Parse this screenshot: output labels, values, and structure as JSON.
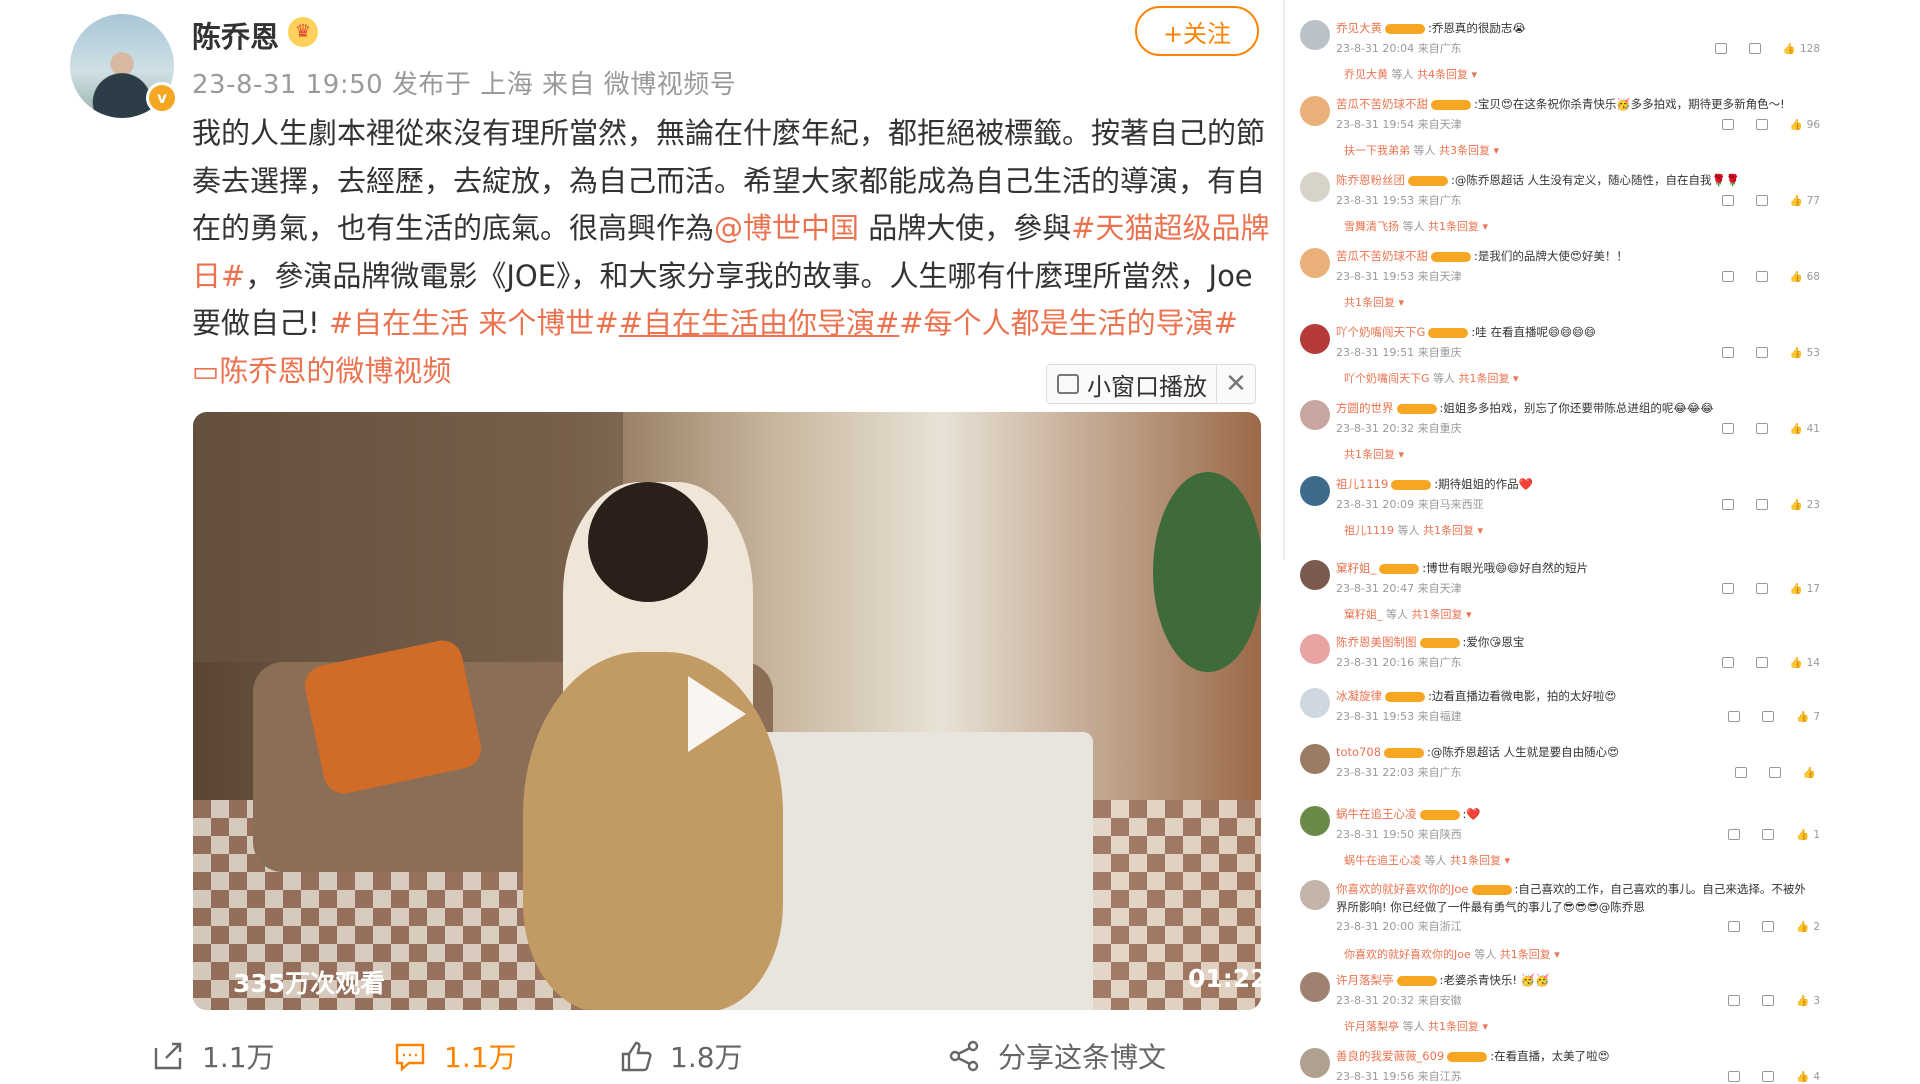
{
  "post": {
    "author": "陈乔恩",
    "meta": "23-8-31 19:50  发布于 上海  来自 微博视频号",
    "follow_label": "+关注",
    "text_1": "我的人生劇本裡從來沒有理所當然，無論在什麼年紀，都拒絕被標籤。按著自己的節奏去選擇，去經歷，去綻放，為自己而活。希望大家都能成為自己生活的導演，有自在的勇氣，也有生活的底氣。很高興作為",
    "mention": "@博世中国",
    "text_2": " 品牌大使，參與",
    "tag_1": "#天猫超级品牌日#",
    "text_3": "，參演品牌微電影《JOE》，和大家分享我的故事。人生哪有什麼理所當然，Joe要做自己! ",
    "tag_2": "#自在生活 来个博世#",
    "tag_3": "#自在生活由你导演#",
    "tag_4": "#每个人都是生活的导演#",
    "video_link": " ▭陈乔恩的微博视频",
    "mini_player_label": "小窗口播放",
    "mini_close": "✕",
    "video_views": "335万次观看",
    "video_duration": "01:22",
    "actions": {
      "repost": "1.1万",
      "comment": "1.1万",
      "like": "1.8万",
      "share": "分享这条博文"
    }
  },
  "comments": [
    {
      "user": "乔见大黄",
      "text": ":乔恩真的很励志😭",
      "meta": "23-8-31 20:04 来自广东",
      "likes": "128",
      "reply_users": "乔见大黄",
      "reply_count": "共4条回复",
      "av": "#b9c2c8"
    },
    {
      "user": "苦瓜不苦奶球不甜",
      "text": ":宝贝😍在这条祝你杀青快乐🥳多多拍戏，期待更多新角色～!",
      "meta": "23-8-31 19:54 来自天津",
      "likes": "96",
      "reply_users": "扶一下我弟弟",
      "reply_count": "共3条回复",
      "av": "#e9b07a"
    },
    {
      "user": "陈乔恩粉丝团",
      "text": ":@陈乔恩超话 人生没有定义，随心随性，自在自我🌹🌹",
      "meta": "23-8-31 19:53 来自广东",
      "likes": "77",
      "reply_users": "雪舞清飞扬",
      "reply_count": "共1条回复",
      "av": "#d8d3c8"
    },
    {
      "user": "苦瓜不苦奶球不甜",
      "text": ":是我们的品牌大使😍好美！！",
      "meta": "23-8-31 19:53 来自天津",
      "likes": "68",
      "reply_users": "",
      "reply_count": "共1条回复",
      "av": "#e9b07a"
    },
    {
      "user": "吖个奶嘴闯天下G",
      "text": ":哇 在看直播呢😄😄😄😄",
      "meta": "23-8-31 19:51 来自重庆",
      "likes": "53",
      "reply_users": "吖个奶嘴闯天下G",
      "reply_count": "共1条回复",
      "av": "#b53a3a"
    },
    {
      "user": "方圆的世界",
      "text": ":姐姐多多拍戏，别忘了你还要带陈总进组的呢😂😂😂",
      "meta": "23-8-31 20:32 来自重庆",
      "likes": "41",
      "reply_users": "",
      "reply_count": "共1条回复",
      "av": "#c8a6a0"
    },
    {
      "user": "祖儿1119",
      "text": ":期待姐姐的作品❤️",
      "meta": "23-8-31 20:09 来自马来西亚",
      "likes": "23",
      "reply_users": "祖儿1119",
      "reply_count": "共1条回复",
      "av": "#3e6a8c"
    },
    {
      "user": "窠籽姐_",
      "text": ":博世有眼光哦😄😄好自然的短片",
      "meta": "23-8-31 20:47 来自天津",
      "likes": "17",
      "reply_users": "窠籽姐_",
      "reply_count": "共1条回复",
      "av": "#7b5a50"
    },
    {
      "user": "陈乔恩美图制图",
      "text": ":爱你😘恩宝",
      "meta": "23-8-31 20:16 来自广东",
      "likes": "14",
      "reply_users": "",
      "reply_count": "",
      "av": "#e8a3a3"
    },
    {
      "user": "冰凝旋律",
      "text": ":边看直播边看微电影，拍的太好啦😍",
      "meta": "23-8-31 19:53 来自福建",
      "likes": "7",
      "reply_users": "",
      "reply_count": "",
      "av": "#cfd8e0"
    },
    {
      "user": "toto708",
      "text": ":@陈乔恩超话 人生就是要自由随心😍",
      "meta": "23-8-31 22:03 来自广东",
      "likes": "",
      "reply_users": "",
      "reply_count": "",
      "av": "#9b7b63"
    },
    {
      "user": "蜗牛在追王心凌",
      "text": ":❤️",
      "meta": "23-8-31 19:50 来自陕西",
      "likes": "1",
      "reply_users": "蜗牛在追王心凌",
      "reply_count": "共1条回复",
      "av": "#6a8a4a"
    },
    {
      "user": "你喜欢的就好喜欢你的Joe",
      "text": ":自己喜欢的工作，自己喜欢的事儿。自己来选择。不被外界所影响! 你已经做了一件最有勇气的事儿了😎😎😎@陈乔恩",
      "meta": "23-8-31 20:00 来自浙江",
      "likes": "2",
      "reply_users": "你喜欢的就好喜欢你的Joe",
      "reply_count": "共1条回复",
      "av": "#c4b3a8"
    },
    {
      "user": "许月落梨亭",
      "text": ":老婆杀青快乐! 🥳🥳",
      "meta": "23-8-31 20:32 来自安徽",
      "likes": "3",
      "reply_users": "许月落梨亭",
      "reply_count": "共1条回复",
      "av": "#a08070"
    },
    {
      "user": "善良的我爱薇薇_609",
      "text": ":在看直播，太美了啦😍",
      "meta": "23-8-31 19:56 来自江苏",
      "likes": "4",
      "reply_users": "",
      "reply_count": "",
      "av": "#b0a090"
    }
  ]
}
